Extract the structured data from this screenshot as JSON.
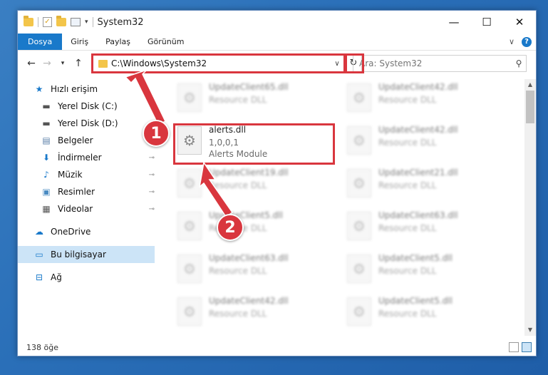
{
  "window": {
    "title": "System32",
    "controls": {
      "minimize": "—",
      "maximize": "☐",
      "close": "✕"
    }
  },
  "ribbon": {
    "tabs": [
      "Dosya",
      "Giriş",
      "Paylaş",
      "Görünüm"
    ],
    "help": "?"
  },
  "nav": {
    "address": "C:\\Windows\\System32",
    "search_placeholder": "Ara: System32"
  },
  "sidebar": {
    "items": [
      {
        "label": "Hızlı erişim",
        "icon": "star-icon"
      },
      {
        "label": "Yerel Disk (C:)",
        "icon": "drive-icon"
      },
      {
        "label": "Yerel Disk (D:)",
        "icon": "drive-icon"
      },
      {
        "label": "Belgeler",
        "icon": "documents-icon"
      },
      {
        "label": "İndirmeler",
        "icon": "download-icon"
      },
      {
        "label": "Müzik",
        "icon": "music-icon"
      },
      {
        "label": "Resimler",
        "icon": "pictures-icon"
      },
      {
        "label": "Videolar",
        "icon": "videos-icon"
      },
      {
        "label": "OneDrive",
        "icon": "cloud-icon"
      },
      {
        "label": "Bu bilgisayar",
        "icon": "computer-icon"
      },
      {
        "label": "Ağ",
        "icon": "network-icon"
      }
    ]
  },
  "files": [
    {
      "name": "UpdateClient65.dll",
      "desc": "Resource DLL"
    },
    {
      "name": "UpdateClient42.dll",
      "desc": "Resource DLL"
    },
    {
      "name": "alerts.dll",
      "version": "1,0,0,1",
      "desc": "Alerts Module"
    },
    {
      "name": "UpdateClient42.dll",
      "desc": "Resource DLL"
    },
    {
      "name": "UpdateClient19.dll",
      "desc": "Resource DLL"
    },
    {
      "name": "UpdateClient21.dll",
      "desc": "Resource DLL"
    },
    {
      "name": "UpdateClient5.dll",
      "desc": "Resource DLL"
    },
    {
      "name": "UpdateClient63.dll",
      "desc": "Resource DLL"
    },
    {
      "name": "UpdateClient63.dll",
      "desc": "Resource DLL"
    },
    {
      "name": "UpdateClient5.dll",
      "desc": "Resource DLL"
    },
    {
      "name": "UpdateClient42.dll",
      "desc": "Resource DLL"
    },
    {
      "name": "UpdateClient5.dll",
      "desc": "Resource DLL"
    }
  ],
  "status": {
    "count": "138 öğe"
  },
  "annotations": {
    "step1": "1",
    "step2": "2"
  },
  "colors": {
    "accent": "#1979ca",
    "highlight": "#d9363e",
    "selection": "#cce4f7"
  }
}
